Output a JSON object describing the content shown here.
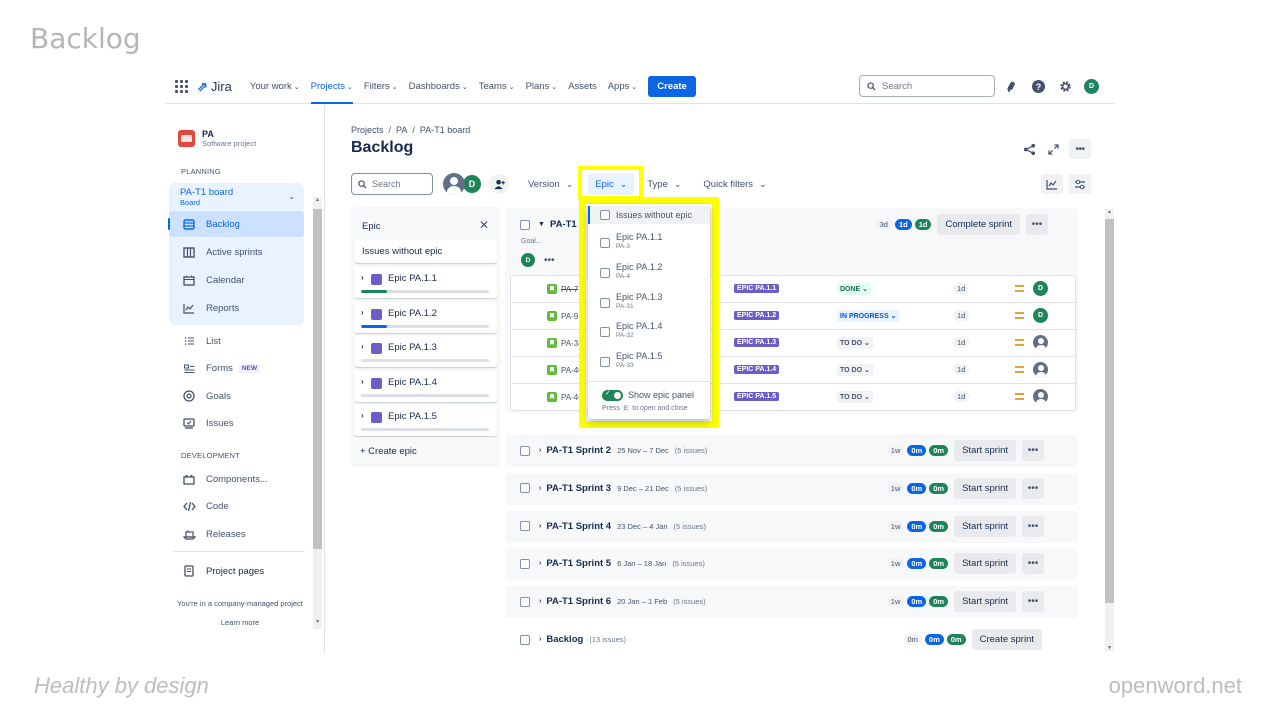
{
  "slide": {
    "title": "Backlog",
    "footer_left": "Healthy by design",
    "footer_right": "openword.net"
  },
  "topnav": {
    "logo": "Jira",
    "items": [
      {
        "label": "Your work",
        "dropdown": true,
        "active": false
      },
      {
        "label": "Projects",
        "dropdown": true,
        "active": true
      },
      {
        "label": "Filters",
        "dropdown": true,
        "active": false
      },
      {
        "label": "Dashboards",
        "dropdown": true,
        "active": false
      },
      {
        "label": "Teams",
        "dropdown": true,
        "active": false
      },
      {
        "label": "Plans",
        "dropdown": true,
        "active": false
      },
      {
        "label": "Assets",
        "dropdown": false,
        "active": false
      },
      {
        "label": "Apps",
        "dropdown": true,
        "active": false
      }
    ],
    "create_label": "Create",
    "search_placeholder": "Search",
    "user_initial": "D",
    "icons": [
      "notifications-icon",
      "help-icon",
      "settings-icon"
    ]
  },
  "sidebar": {
    "project_name": "PA",
    "project_type": "Software project",
    "planning_title": "PLANNING",
    "board_name": "PA-T1 board",
    "board_sub": "Board",
    "planning_items": [
      {
        "label": "Backlog",
        "icon": "backlog-icon",
        "active": true
      },
      {
        "label": "Active sprints",
        "icon": "columns-icon",
        "active": false
      },
      {
        "label": "Calendar",
        "icon": "calendar-icon",
        "active": false
      },
      {
        "label": "Reports",
        "icon": "reports-icon",
        "active": false
      }
    ],
    "other_items": [
      {
        "label": "List",
        "icon": "list-icon"
      },
      {
        "label": "Forms",
        "icon": "forms-icon",
        "badge": "NEW"
      },
      {
        "label": "Goals",
        "icon": "goals-icon"
      },
      {
        "label": "Issues",
        "icon": "issues-icon"
      }
    ],
    "development_title": "DEVELOPMENT",
    "development_items": [
      {
        "label": "Components...",
        "icon": "components-icon"
      },
      {
        "label": "Code",
        "icon": "code-icon"
      },
      {
        "label": "Releases",
        "icon": "releases-icon"
      }
    ],
    "project_pages": "Project pages",
    "footer_text": "You're in a company-managed project",
    "learn_more": "Learn more"
  },
  "main": {
    "breadcrumb": [
      "Projects",
      "PA",
      "PA-T1 board"
    ],
    "title": "Backlog",
    "search_placeholder": "Search",
    "avatar_initial": "D",
    "filters": [
      {
        "label": "Version",
        "selected": false
      },
      {
        "label": "Epic",
        "selected": true
      },
      {
        "label": "Type",
        "selected": false
      },
      {
        "label": "Quick filters",
        "selected": false
      }
    ]
  },
  "epic_panel": {
    "title": "Epic",
    "no_epic": "Issues without epic",
    "epics": [
      {
        "name": "Epic PA.1.1",
        "progress": 0.2,
        "progress_color": "#1f845a"
      },
      {
        "name": "Epic PA.1.2",
        "progress": 0.2,
        "progress_color": "#0c66e4"
      },
      {
        "name": "Epic PA.1.3",
        "progress": 0,
        "progress_color": "#dcdfe4"
      },
      {
        "name": "Epic PA.1.4",
        "progress": 0,
        "progress_color": "#dcdfe4"
      },
      {
        "name": "Epic PA.1.5",
        "progress": 0,
        "progress_color": "#dcdfe4"
      }
    ],
    "create_label": "+ Create epic"
  },
  "epic_dropdown": {
    "no_epic": "Issues without epic",
    "options": [
      {
        "name": "Epic PA.1.1",
        "key": "PA-3"
      },
      {
        "name": "Epic PA.1.2",
        "key": "PA-4"
      },
      {
        "name": "Epic PA.1.3",
        "key": "PA-31"
      },
      {
        "name": "Epic PA.1.4",
        "key": "PA-32"
      },
      {
        "name": "Epic PA.1.5",
        "key": "PA-33"
      }
    ],
    "toggle_label": "Show epic panel",
    "toggle_on": true,
    "hint_pre": "Press",
    "hint_key": "E",
    "hint_post": "to open and close"
  },
  "active_sprint": {
    "name": "PA-T1 S",
    "goal": "Goal...",
    "assignee": "D",
    "counts": {
      "todo": "3d",
      "progress": "1d",
      "done": "1d"
    },
    "action": "Complete sprint",
    "issues": [
      {
        "key": "PA-7",
        "done": true,
        "epic": "EPIC PA.1.1",
        "status": "DONE",
        "status_type": "done",
        "estimate": "1d",
        "assignee": "D"
      },
      {
        "key": "PA-9",
        "done": false,
        "epic": "EPIC PA.1.2",
        "status": "IN PROGRESS",
        "status_type": "prog",
        "estimate": "1d",
        "assignee": "D"
      },
      {
        "key": "PA-34",
        "done": false,
        "epic": "EPIC PA.1.3",
        "status": "TO DO",
        "status_type": "todo",
        "estimate": "1d",
        "assignee": ""
      },
      {
        "key": "PA-40",
        "done": false,
        "epic": "EPIC PA.1.4",
        "status": "TO DO",
        "status_type": "todo",
        "estimate": "1d",
        "assignee": ""
      },
      {
        "key": "PA-46",
        "done": false,
        "epic": "EPIC PA.1.5",
        "status": "TO DO",
        "status_type": "todo",
        "estimate": "1d",
        "assignee": ""
      }
    ]
  },
  "sprints": [
    {
      "name": "PA-T1 Sprint 2",
      "dates": "25 Nov – 7 Dec",
      "count": "(5 issues)",
      "c1": "1w",
      "c2": "0m",
      "c3": "0m",
      "action": "Start sprint"
    },
    {
      "name": "PA-T1 Sprint 3",
      "dates": "9 Dec – 21 Dec",
      "count": "(5 issues)",
      "c1": "1w",
      "c2": "0m",
      "c3": "0m",
      "action": "Start sprint"
    },
    {
      "name": "PA-T1 Sprint 4",
      "dates": "23 Dec – 4 Jan",
      "count": "(5 issues)",
      "c1": "1w",
      "c2": "0m",
      "c3": "0m",
      "action": "Start sprint"
    },
    {
      "name": "PA-T1 Sprint 5",
      "dates": "6 Jan – 18 Jan",
      "count": "(5 issues)",
      "c1": "1w",
      "c2": "0m",
      "c3": "0m",
      "action": "Start sprint"
    },
    {
      "name": "PA-T1 Sprint 6",
      "dates": "20 Jan – 1 Feb",
      "count": "(5 issues)",
      "c1": "1w",
      "c2": "0m",
      "c3": "0m",
      "action": "Start sprint"
    }
  ],
  "backlog": {
    "name": "Backlog",
    "count": "(13 issues)",
    "c1": "0m",
    "c2": "0m",
    "c3": "0m",
    "action": "Create sprint"
  }
}
